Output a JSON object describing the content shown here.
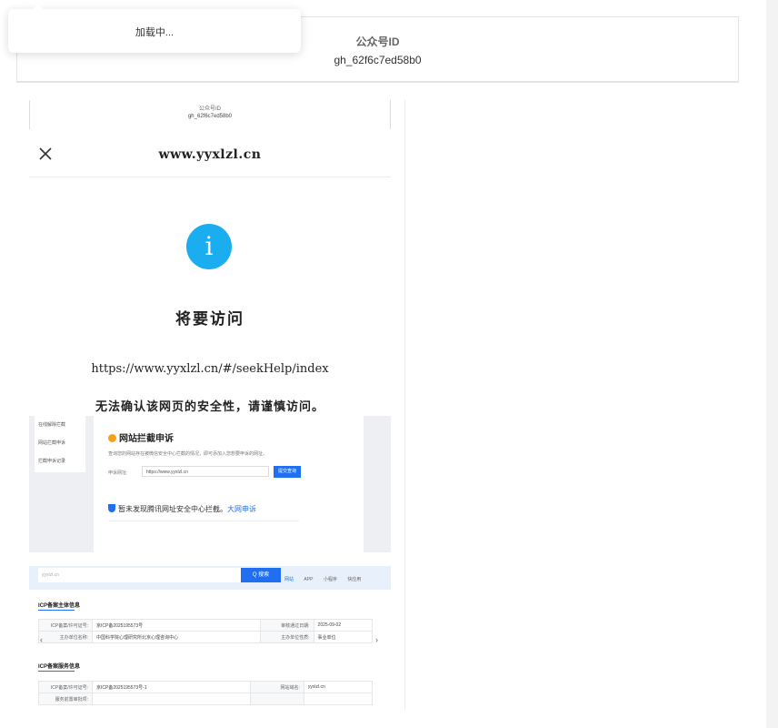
{
  "toast": {
    "message": "加载中..."
  },
  "account": {
    "id_label": "公众号ID",
    "id_value": "gh_62f6c7ed58b0"
  },
  "screenshot": {
    "mini_id_label": "公众号ID",
    "mini_id_value": "gh_62f6c7ed58b0",
    "domain": "www.yyxlzl.cn",
    "heading": "将要访问",
    "url": "https://www.yyxlzl.cn/#/seekHelp/index",
    "warning": "无法确认该网页的安全性，请谨慎访问。",
    "info_glyph": "i",
    "appeal": {
      "menu": [
        "在线解除拦截",
        "网站拦截申诉",
        "拦截申诉记录"
      ],
      "title": "网站拦截申诉",
      "description": "查询您的网站存在被微信安全中心拦截的情况，即可添加入您想要申诉的网址。",
      "field_label": "申诉网址:",
      "field_value": "https://www.yyxlzl.cn",
      "button": "提交查询",
      "result": "暂未发现腾讯网址安全中心拦截。",
      "result_link": "大网申诉"
    },
    "icp": {
      "search_value": "yyxlzl.cn",
      "search_button": "Q 搜索",
      "options": [
        "网站",
        "APP",
        "小程序",
        "快应用"
      ],
      "selected_option": "网站",
      "subject_title": "ICP备案主体信息",
      "subject_rows": [
        [
          "ICP备案/许可证号:",
          "京ICP备2025195573号",
          "审核通过日期:",
          "2025-09-02"
        ],
        [
          "主办单位名称:",
          "中国科学院心理研究所北京心理咨询中心",
          "主办单位性质:",
          "事业单位"
        ]
      ],
      "service_title": "ICP备案服务信息",
      "service_rows": [
        [
          "ICP备案/许可证号:",
          "京ICP备2025195573号-1",
          "网站域名:",
          "yyxlzl.cn"
        ],
        [
          "服务前置审批项:",
          "",
          "",
          ""
        ]
      ]
    }
  }
}
